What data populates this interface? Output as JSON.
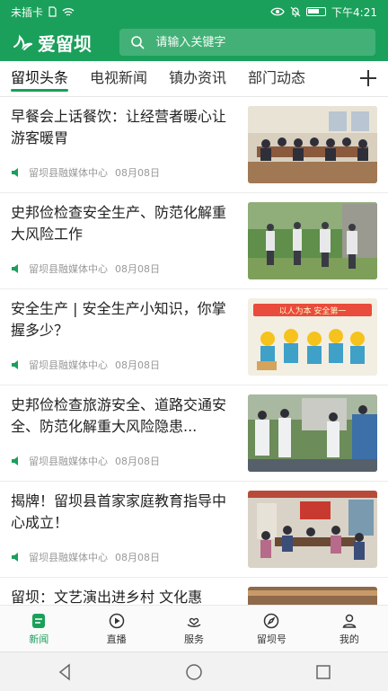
{
  "status": {
    "carrier": "未插卡",
    "time": "下午4:21"
  },
  "app": {
    "name": "爱留坝"
  },
  "search": {
    "placeholder": "请输入关键字"
  },
  "tabs": [
    {
      "label": "留坝头条"
    },
    {
      "label": "电视新闻"
    },
    {
      "label": "镇办资讯"
    },
    {
      "label": "部门动态"
    }
  ],
  "feed": [
    {
      "title": "早餐会上话餐饮：让经营者暖心让游客暖胃",
      "source": "留坝县融媒体中心",
      "date": "08月08日"
    },
    {
      "title": "史邦俭检查安全生产、防范化解重大风险工作",
      "source": "留坝县融媒体中心",
      "date": "08月08日"
    },
    {
      "title": "安全生产 | 安全生产小知识，你掌握多少？",
      "source": "留坝县融媒体中心",
      "date": "08月08日"
    },
    {
      "title": "史邦俭检查旅游安全、道路交通安全、防范化解重大风险隐患...",
      "source": "留坝县融媒体中心",
      "date": "08月08日"
    },
    {
      "title": "揭牌！留坝县首家家庭教育指导中心成立！",
      "source": "留坝县融媒体中心",
      "date": "08月08日"
    },
    {
      "title": "留坝：文艺演出进乡村 文化惠"
    }
  ],
  "thumb_banner": "以人为本 安全第一",
  "bottom_nav": [
    {
      "label": "新闻"
    },
    {
      "label": "直播"
    },
    {
      "label": "服务"
    },
    {
      "label": "留坝号"
    },
    {
      "label": "我的"
    }
  ],
  "colors": {
    "brand": "#1aa05a"
  }
}
